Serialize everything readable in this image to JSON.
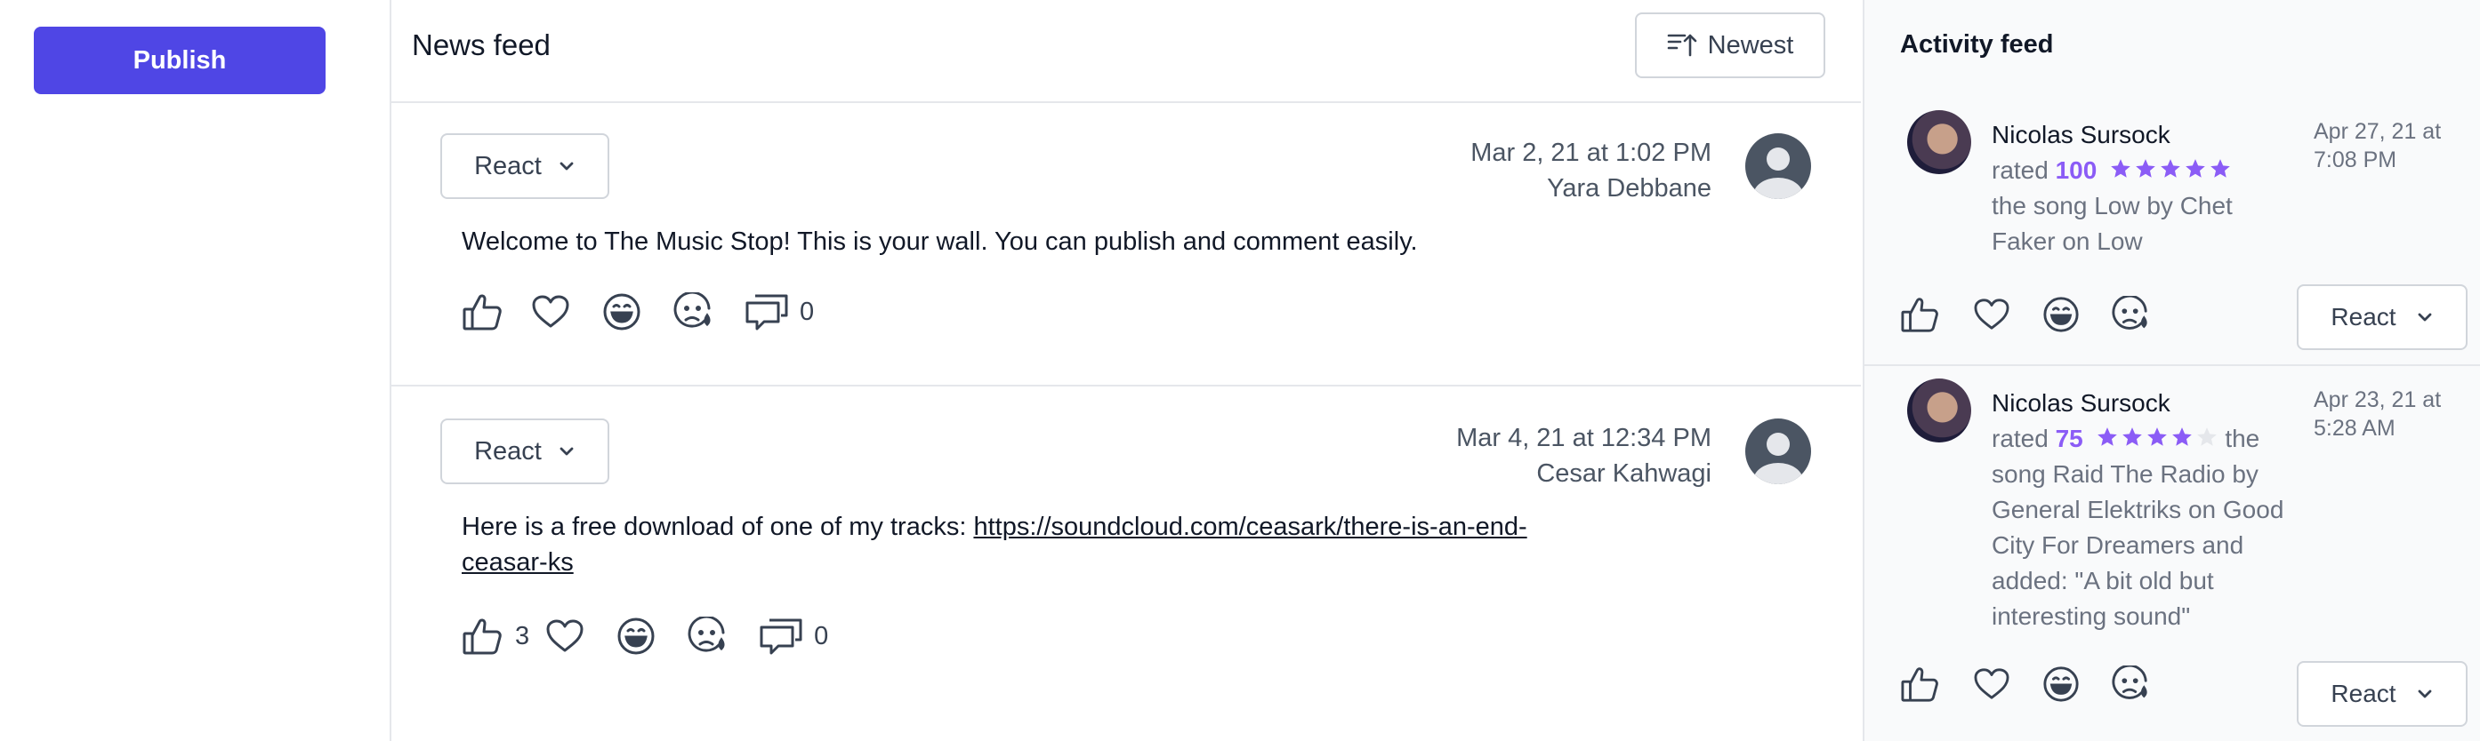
{
  "sidebar": {
    "publish_label": "Publish"
  },
  "feed": {
    "title": "News feed",
    "sort_label": "Newest",
    "posts": [
      {
        "react_label": "React",
        "date": "Mar 2, 21 at 1:02 PM",
        "author": "Yara Debbane",
        "text": "Welcome to The Music Stop! This is your wall. You can publish and comment easily.",
        "comments": "0"
      },
      {
        "react_label": "React",
        "date": "Mar 4, 21 at 12:34 PM",
        "author": "Cesar Kahwagi",
        "text_prefix": "Here is a free download of one of my tracks: ",
        "link": "https://soundcloud.com/ceasark/there-is-an-end-ceasar-ks",
        "link_line1": "https://soundcloud.com/ceasark/there-is-an-end-",
        "link_line2": "ceasar-ks",
        "likes": "3",
        "comments": "0"
      }
    ]
  },
  "activity": {
    "title": "Activity feed",
    "items": [
      {
        "user": "Nicolas Sursock",
        "rated_word": "rated",
        "rating": "100",
        "stars_filled": 5,
        "stars_total": 5,
        "line_text": "the song Low by Chet Faker on Low",
        "date_line1": "Apr 27, 21 at",
        "date_line2": "7:08 PM",
        "react_label": "React"
      },
      {
        "user": "Nicolas Sursock",
        "rated_word": "rated",
        "rating": "75",
        "stars_filled": 4,
        "stars_total": 5,
        "line_text": "the song Raid The Radio by General Elektriks on Good City For Dreamers and added: \"A bit old but interesting sound\"",
        "date_line1": "Apr 23, 21 at",
        "date_line2": "5:28 AM",
        "react_label": "React"
      }
    ]
  },
  "colors": {
    "accent": "#4f46e5",
    "star": "#8b5cf6",
    "star_empty": "#e5e7eb"
  }
}
